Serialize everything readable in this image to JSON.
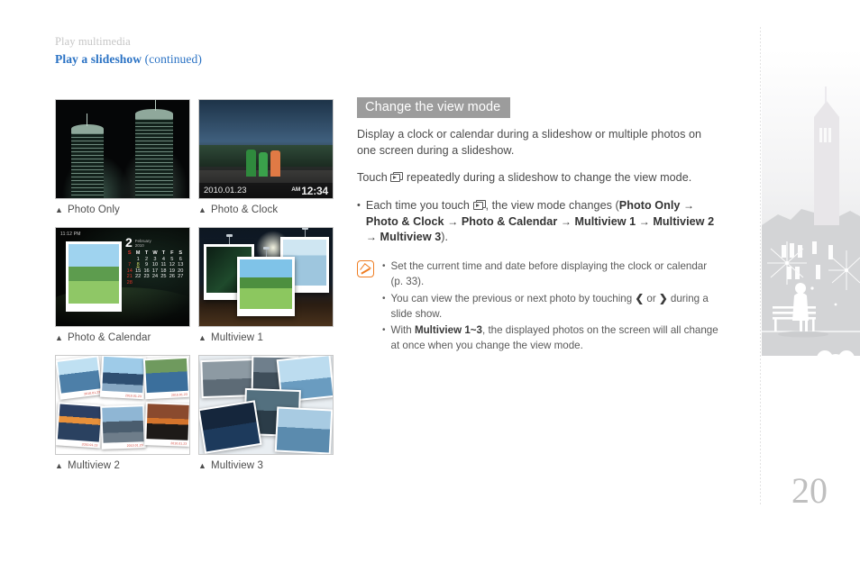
{
  "header": {
    "kicker": "Play multimedia",
    "title": "Play a slideshow",
    "continued": "(continued)"
  },
  "figures": [
    {
      "caption": "Photo Only",
      "marker": "▲"
    },
    {
      "caption": "Photo & Clock",
      "marker": "▲"
    },
    {
      "caption": "Photo & Calendar",
      "marker": "▲"
    },
    {
      "caption": "Multiview 1",
      "marker": "▲"
    },
    {
      "caption": "Multiview 2",
      "marker": "▲"
    },
    {
      "caption": "Multiview 3",
      "marker": "▲"
    }
  ],
  "clock_overlay": {
    "date": "2010.01.23",
    "ampm": "AM",
    "time": "12:34"
  },
  "calendar_overlay": {
    "month_number": "2",
    "month_name": "February",
    "year": "2010",
    "day_headers": [
      "S",
      "M",
      "T",
      "W",
      "T",
      "F",
      "S"
    ],
    "weeks": [
      [
        "",
        "1",
        "2",
        "3",
        "4",
        "5",
        "6"
      ],
      [
        "7",
        "8",
        "9",
        "10",
        "11",
        "12",
        "13"
      ],
      [
        "14",
        "15",
        "16",
        "17",
        "18",
        "19",
        "20"
      ],
      [
        "21",
        "22",
        "23",
        "24",
        "25",
        "26",
        "27"
      ],
      [
        "28",
        "",
        "",
        "",
        "",
        "",
        ""
      ]
    ],
    "today": "8",
    "small_clock": "11:12 PM"
  },
  "section": {
    "heading": "Change the view mode",
    "intro": "Display a clock or calendar during a slideshow or multiple photos on one screen during a slideshow.",
    "touch_pre": "Touch",
    "touch_post": "repeatedly during a slideshow to change the view mode.",
    "bullet": {
      "pre": "Each time you touch",
      "mid": ", the view mode changes (",
      "modes": [
        "Photo Only",
        "Photo & Clock",
        "Photo & Calendar",
        "Multiview 1",
        "Multiview 2",
        "Multiview 3"
      ],
      "arrow": "→",
      "close": ")."
    }
  },
  "note": {
    "icon": "note-pencil-icon",
    "items": [
      {
        "text": "Set the current time and date before displaying the clock or calendar (p. 33)."
      },
      {
        "pre": "You can view the previous or next photo by touching",
        "left_arrow": "❮",
        "or": "or",
        "right_arrow": "❯",
        "post": "during a slide show."
      },
      {
        "pre": "With",
        "bold": "Multiview 1~3",
        "post": ", the displayed photos on the screen will all change at once when you change the view mode."
      }
    ]
  },
  "page_number": "20",
  "colors": {
    "accent_blue": "#2a72c4",
    "heading_bar": "#9c9c9c",
    "note_orange": "#ef7d22",
    "page_number": "#bfbfbf"
  }
}
